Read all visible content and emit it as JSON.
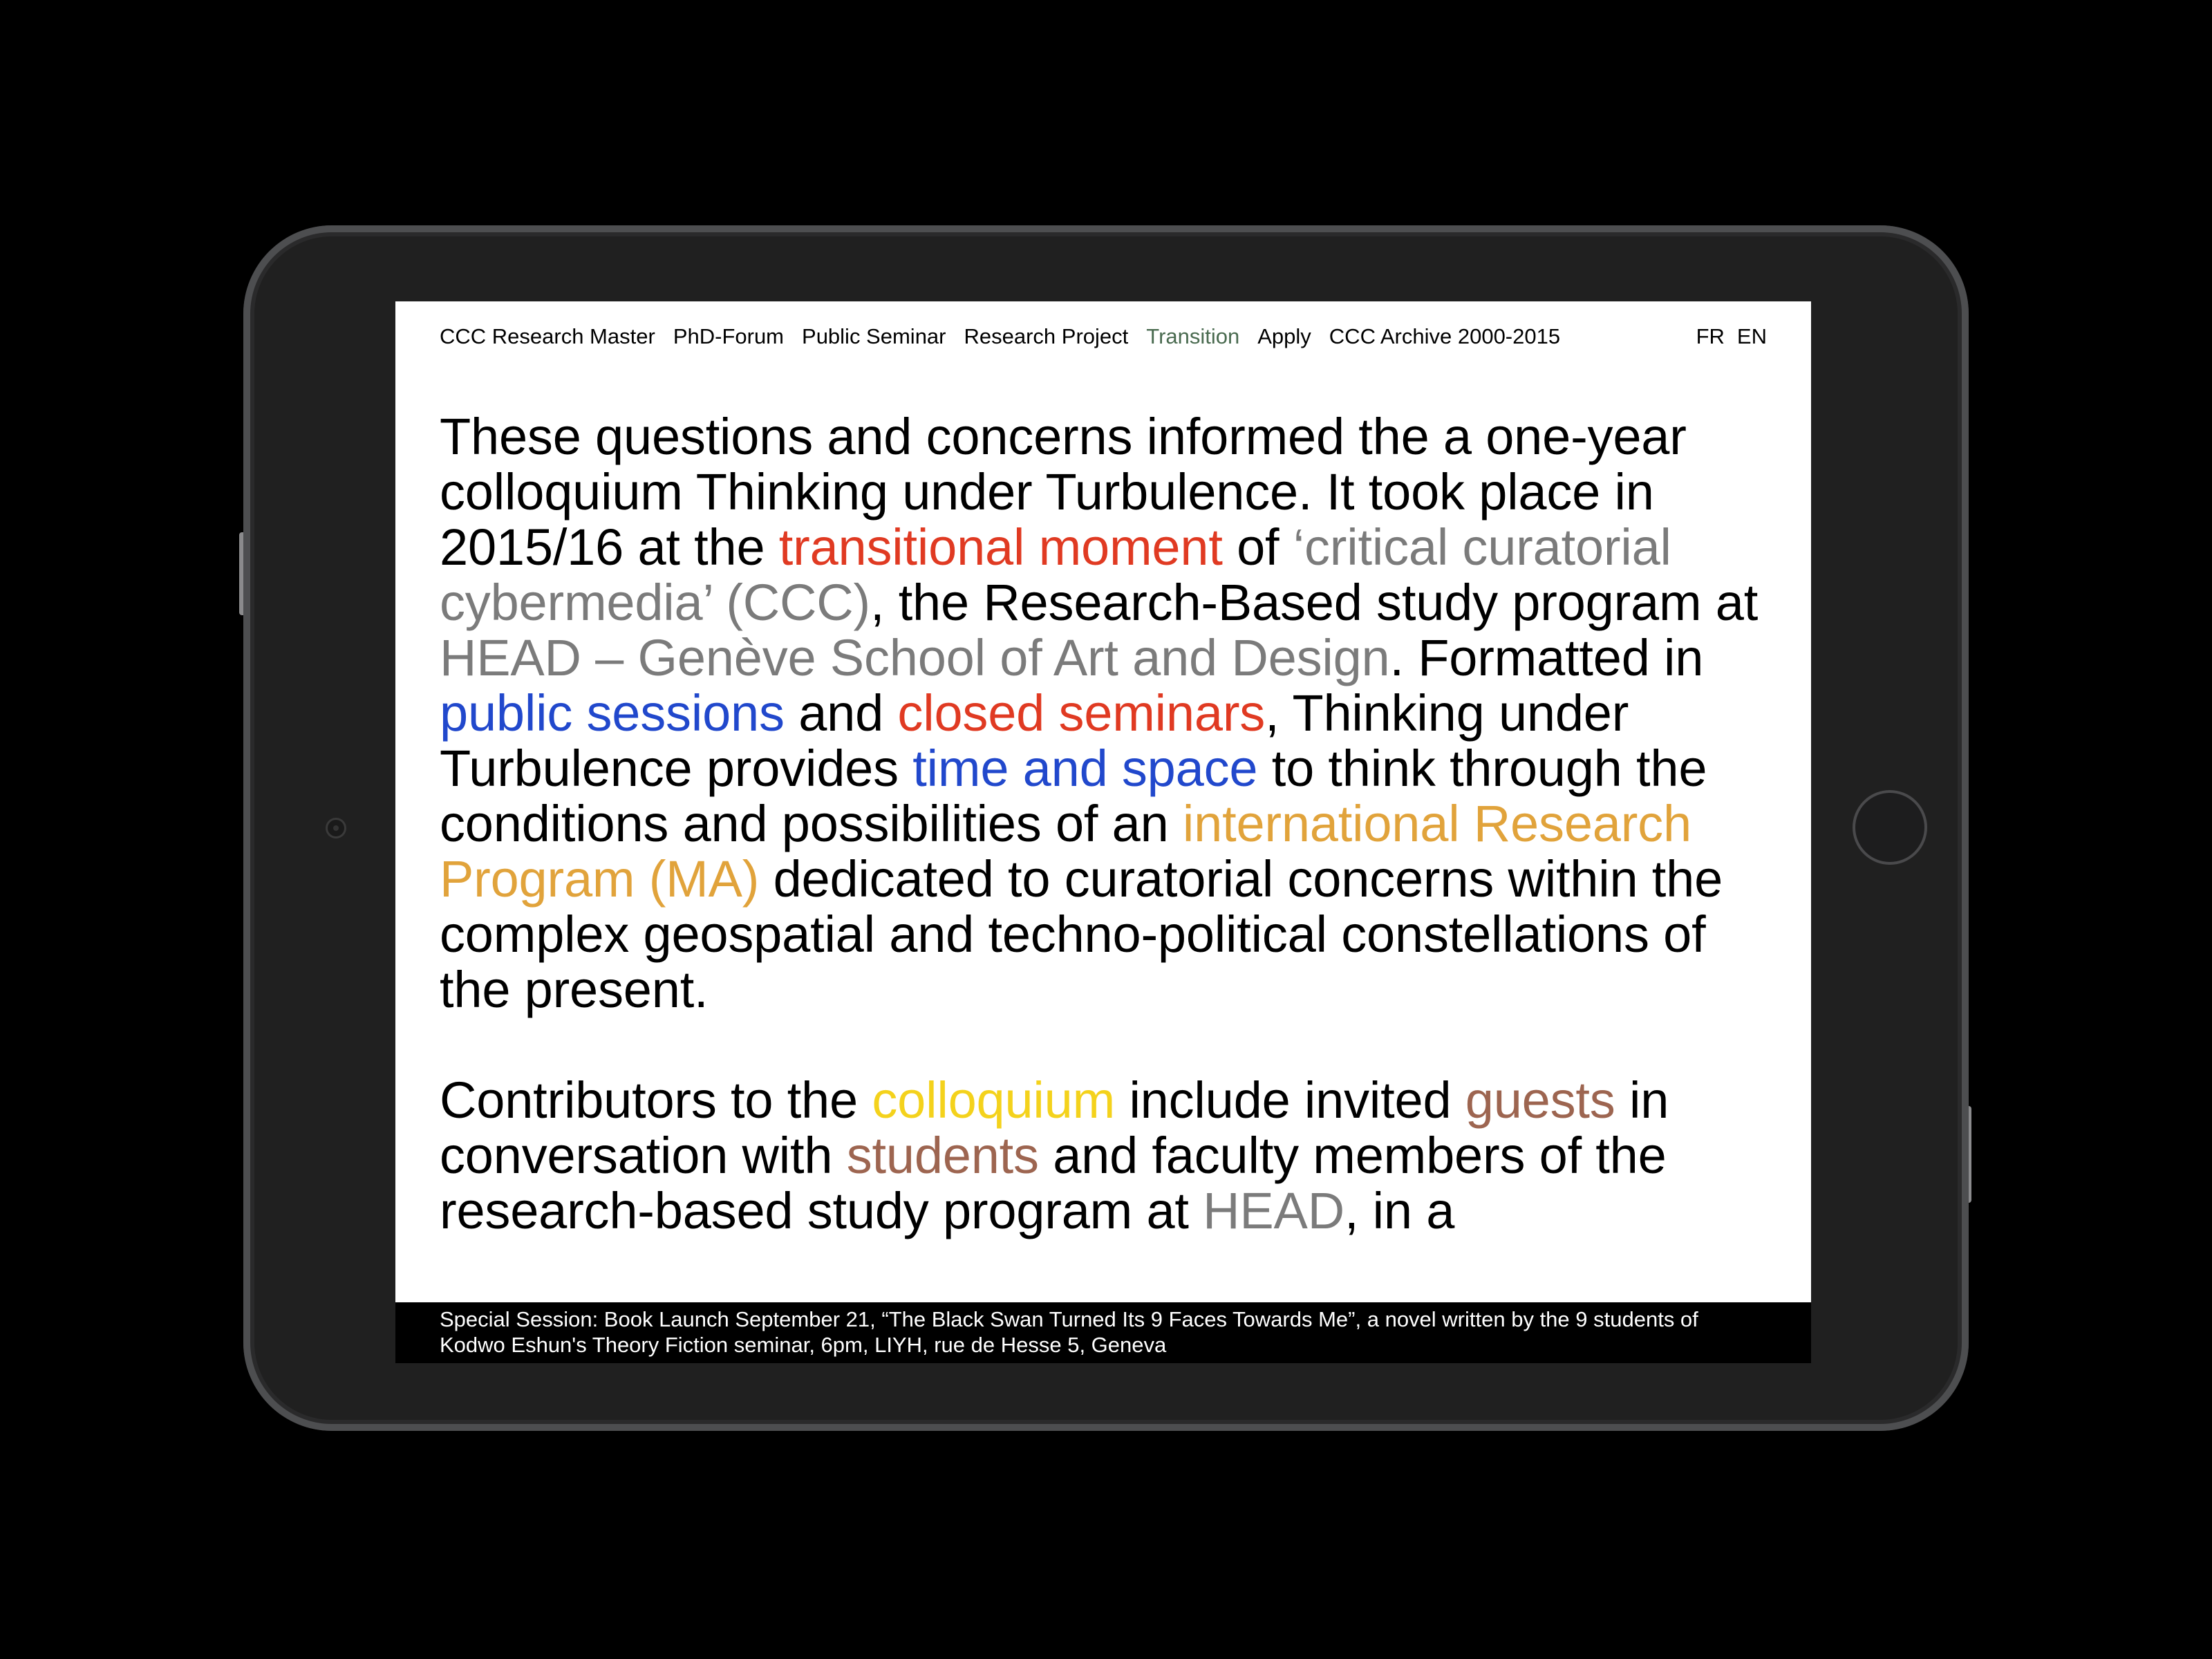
{
  "nav": {
    "items": [
      {
        "label": "CCC Research Master"
      },
      {
        "label": "PhD-Forum"
      },
      {
        "label": "Public Seminar"
      },
      {
        "label": "Research Project"
      },
      {
        "label": "Transition"
      },
      {
        "label": "Apply"
      },
      {
        "label": "CCC Archive 2000-2015"
      }
    ],
    "active": "Transition",
    "lang": [
      "FR",
      "EN"
    ]
  },
  "paragraph1": {
    "t1": "These questions and concerns informed the a one-year colloquium Thinking under Turbulence. It took place in 2015/16 at the ",
    "l1": "transitional moment",
    "t2": " of ",
    "l2": "‘critical curatorial cybermedia’ (CCC)",
    "t3": ", the Research-Based study program at ",
    "l3": "HEAD – Genève School of Art and Design",
    "t4": ". Formatted in ",
    "l4": "public sessions",
    "t5": " and ",
    "l5": "closed seminars",
    "t6": ", Thinking under Turbulence provides ",
    "l6": "time and space",
    "t7": " to think through the conditions and possibilities of an ",
    "l7": "international Research Program (MA)",
    "t8": " dedicated to curatorial concerns within the complex geospatial and techno-political constellations of the present."
  },
  "paragraph2": {
    "t1": "Contributors to the ",
    "l1": "colloquium",
    "t2": " include invited ",
    "l2": "guests",
    "t3": " in conversation with ",
    "l3": "students",
    "t4": " and faculty members of the research-based study program at ",
    "l4": "HEAD",
    "t5": ", in a"
  },
  "ticker": {
    "text": "Special Session: Book Launch September 21, “The Black Swan Turned Its 9 Faces Towards Me”, a novel written by the 9 students of Kodwo Eshun's Theory Fiction seminar, 6pm, LIYH, rue de Hesse 5, Geneva"
  },
  "colors": {
    "red": "#e03a22",
    "gray": "#7b7b7b",
    "blue": "#2148cc",
    "orange": "#e1a33b",
    "yellow": "#f4d21c",
    "brown": "#9d6550",
    "nav_active": "#4a6b50"
  }
}
